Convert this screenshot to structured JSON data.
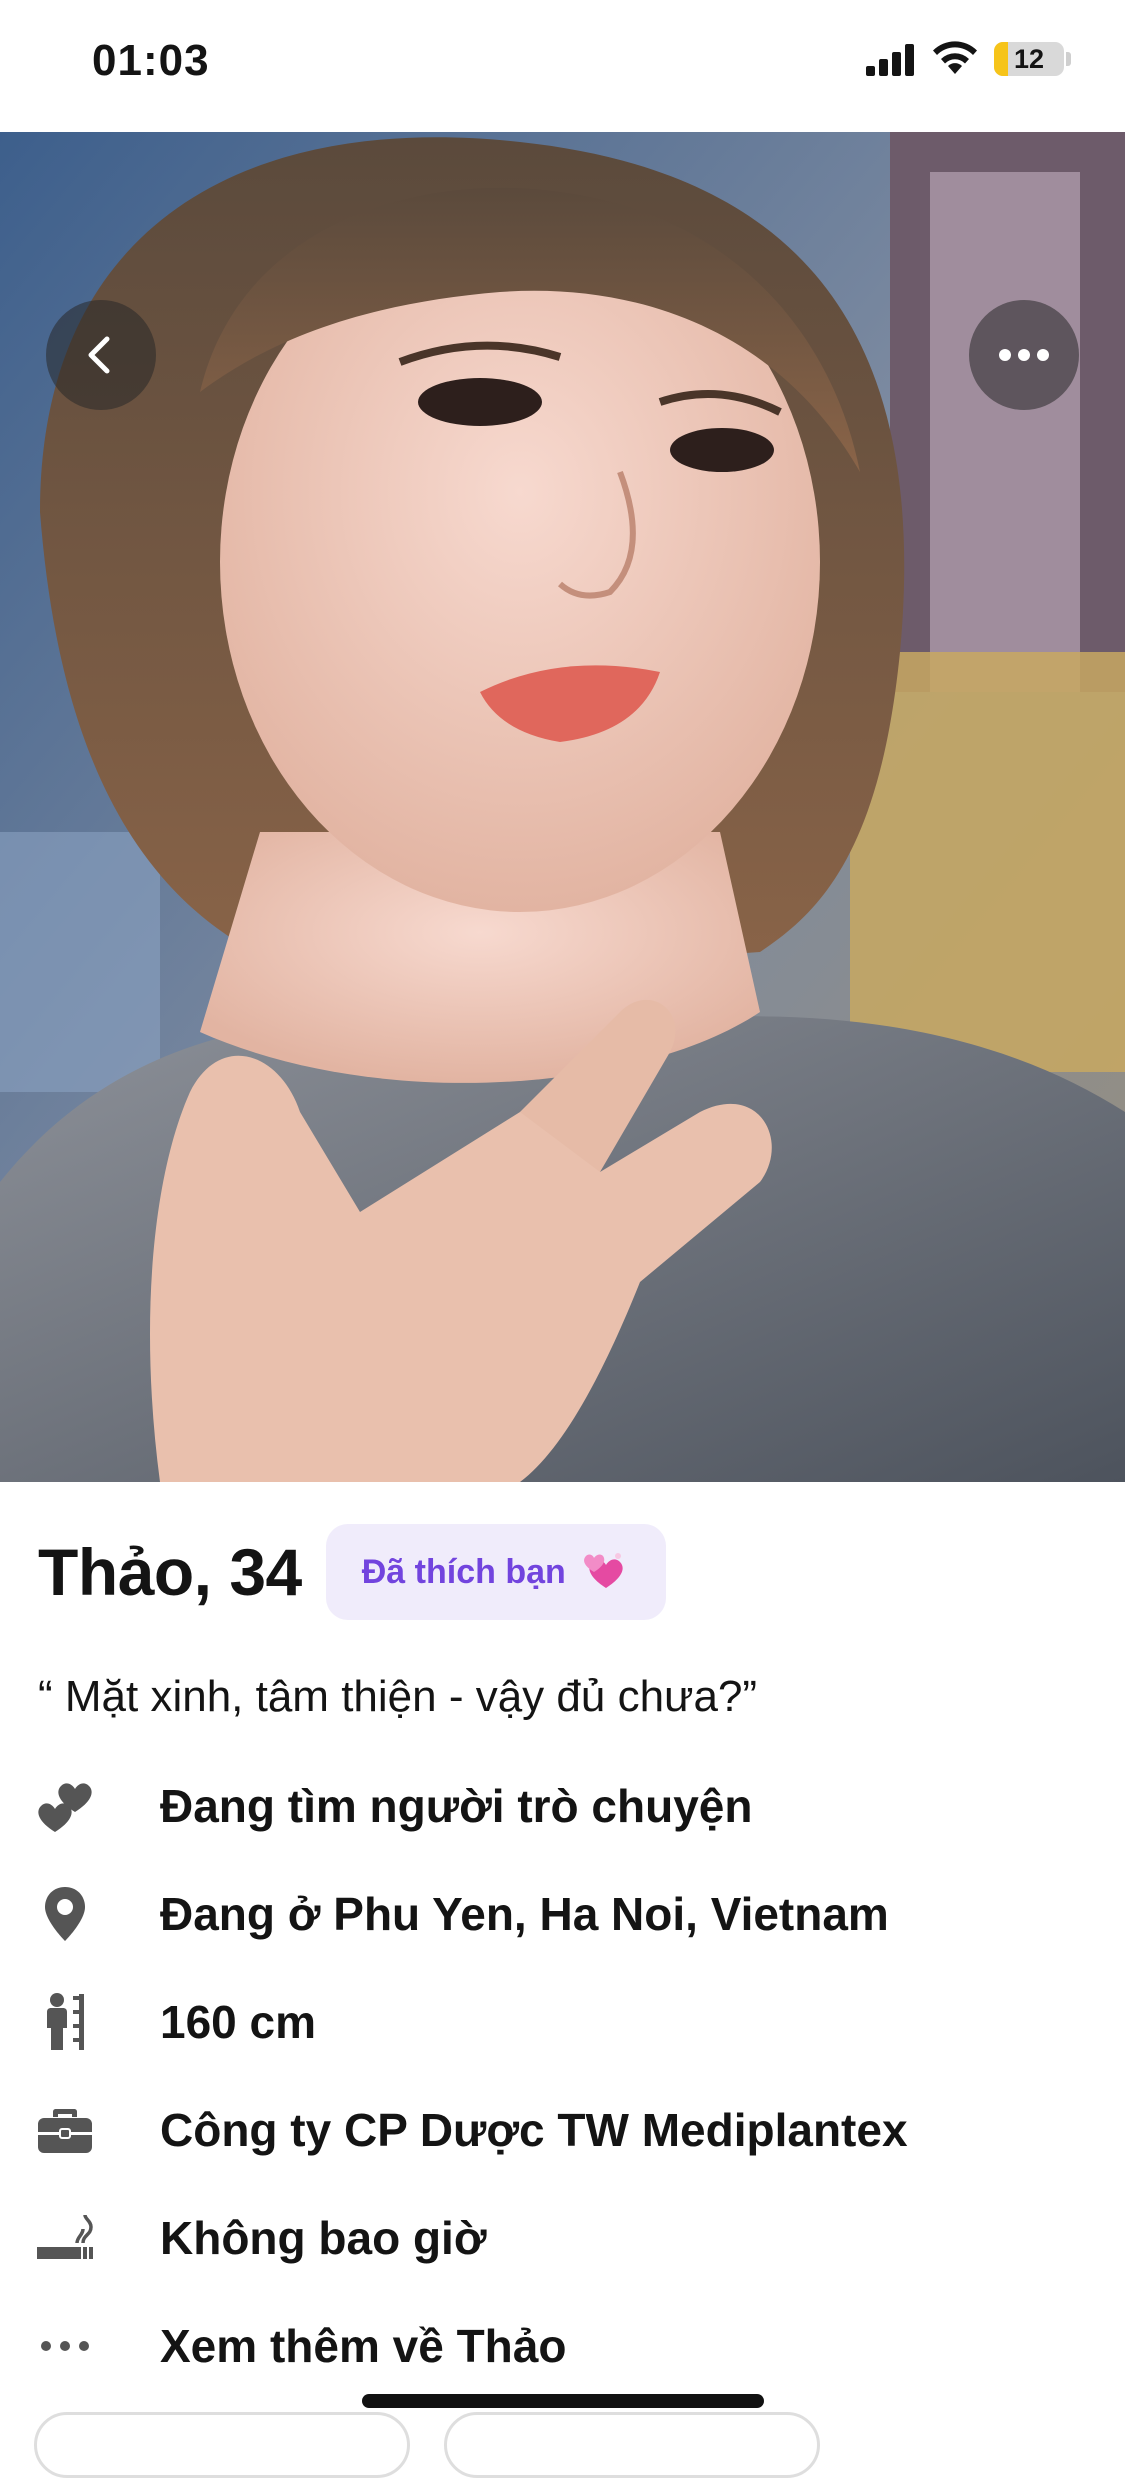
{
  "status_bar": {
    "time": "01:03",
    "battery_level": "12",
    "battery_fraction": 0.12
  },
  "photo": {
    "description_icon": "profile-photo",
    "back_icon": "chevron-left-icon",
    "more_icon": "more-horizontal-icon"
  },
  "profile": {
    "name_age": "Thảo, 34",
    "liked_badge": "Đã thích bạn",
    "liked_emoji": "sparkling-hearts-icon",
    "quote": "“ Mặt xinh, tâm thiện - vậy đủ chưa?”"
  },
  "details": [
    {
      "icon": "hearts-icon",
      "label": "Đang tìm người trò chuyện"
    },
    {
      "icon": "location-pin-icon",
      "label": "Đang ở Phu Yen, Ha Noi, Vietnam"
    },
    {
      "icon": "height-icon",
      "label": "160 cm"
    },
    {
      "icon": "briefcase-icon",
      "label": "Công ty CP Dược TW Mediplantex"
    },
    {
      "icon": "smoking-icon",
      "label": "Không bao giờ"
    },
    {
      "icon": "more-dots-icon",
      "label": "Xem thêm về Thảo"
    }
  ],
  "colors": {
    "badge_background": "#f0ecfb",
    "badge_text": "#7244de",
    "battery_fill": "#f6c41a",
    "text": "#141414",
    "icon": "#555555"
  }
}
